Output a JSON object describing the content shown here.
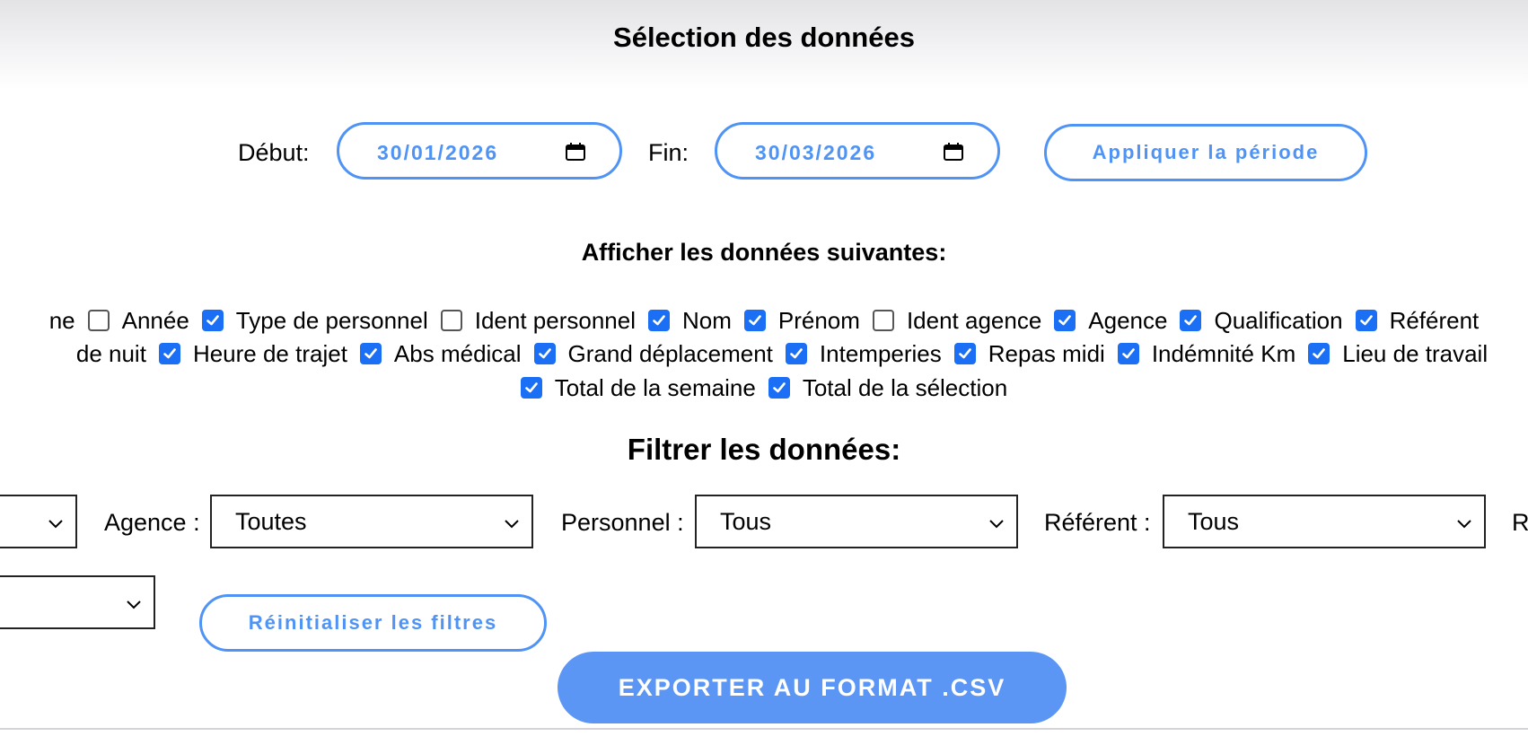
{
  "page_title": "Sélection des données",
  "period": {
    "start_label": "Début:",
    "start_value": "30/01/2026",
    "end_label": "Fin:",
    "end_value": "30/03/2026",
    "apply_label": "Appliquer la période"
  },
  "display": {
    "title": "Afficher les données suivantes:",
    "rows": [
      [
        {
          "label": "ne",
          "checked": null
        },
        {
          "label": "Année",
          "checked": false
        },
        {
          "label": "Type de personnel",
          "checked": true
        },
        {
          "label": "Ident personnel",
          "checked": false
        },
        {
          "label": "Nom",
          "checked": true
        },
        {
          "label": "Prénom",
          "checked": true
        },
        {
          "label": "Ident agence",
          "checked": false
        },
        {
          "label": "Agence",
          "checked": true
        },
        {
          "label": "Qualification",
          "checked": true
        },
        {
          "label": "Référent",
          "checked": true
        }
      ],
      [
        {
          "label": "de nuit",
          "checked": null
        },
        {
          "label": "Heure de trajet",
          "checked": true
        },
        {
          "label": "Abs médical",
          "checked": true
        },
        {
          "label": "Grand déplacement",
          "checked": true
        },
        {
          "label": "Intemperies",
          "checked": true
        },
        {
          "label": "Repas midi",
          "checked": true
        },
        {
          "label": "Indémnité Km",
          "checked": true
        },
        {
          "label": "Lieu de travail",
          "checked": true
        }
      ],
      [
        {
          "label": "Total de la semaine",
          "checked": true
        },
        {
          "label": "Total de la sélection",
          "checked": true
        }
      ]
    ]
  },
  "filters": {
    "title": "Filtrer les données:",
    "agence_label": "Agence :",
    "agence_value": "Toutes",
    "personnel_label": "Personnel :",
    "personnel_value": "Tous",
    "referent_label": "Référent :",
    "referent_value": "Tous",
    "cut_label": "R",
    "reset_label": "Réinitialiser les filtres"
  },
  "export_label": "EXPORTER AU FORMAT .CSV",
  "colors": {
    "accent": "#4f93f5",
    "checkbox": "#1b6ff5",
    "export_bg": "#5b96f5"
  }
}
